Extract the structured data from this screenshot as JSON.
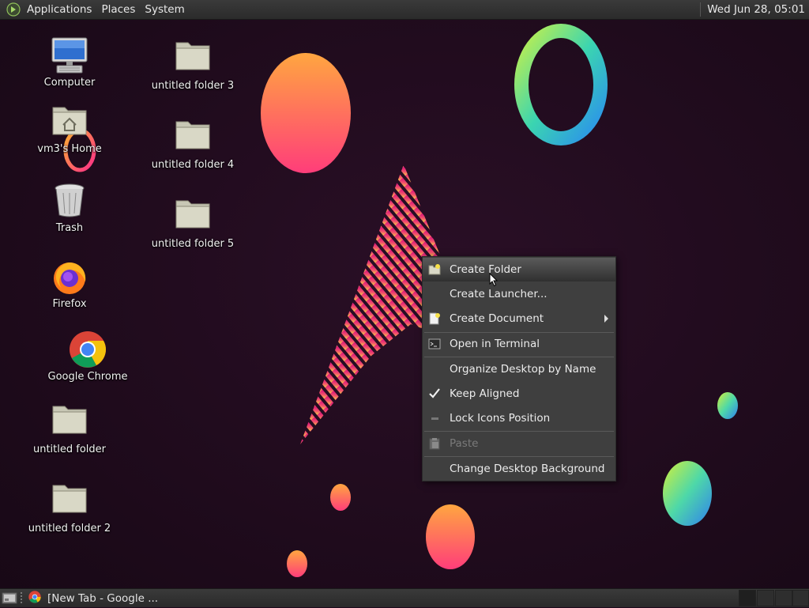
{
  "top_panel": {
    "menus": [
      "Applications",
      "Places",
      "System"
    ],
    "clock": "Wed Jun 28, 05:01"
  },
  "desktop": {
    "icons": [
      {
        "label": "Computer",
        "icon": "computer-icon"
      },
      {
        "label": "vm3's Home",
        "icon": "home-folder-icon"
      },
      {
        "label": "Trash",
        "icon": "trash-icon"
      },
      {
        "label": "Firefox",
        "icon": "firefox-icon"
      },
      {
        "label": "Google Chrome",
        "icon": "chrome-icon"
      },
      {
        "label": "untitled folder",
        "icon": "folder-icon"
      },
      {
        "label": "untitled folder 2",
        "icon": "folder-icon"
      },
      {
        "label": "untitled folder 3",
        "icon": "folder-icon"
      },
      {
        "label": "untitled folder 4",
        "icon": "folder-icon"
      },
      {
        "label": "untitled folder 5",
        "icon": "folder-icon"
      }
    ]
  },
  "context_menu": {
    "items": [
      {
        "label": "Create Folder",
        "icon": "folder-new-icon",
        "highlighted": true
      },
      {
        "label": "Create Launcher...",
        "icon": ""
      },
      {
        "label": "Create Document",
        "icon": "document-new-icon",
        "submenu": true
      },
      {
        "label": "Open in Terminal",
        "icon": "terminal-icon"
      },
      {
        "label": "Organize Desktop by Name",
        "icon": ""
      },
      {
        "label": "Keep Aligned",
        "icon": "checkmark-icon",
        "checked": true
      },
      {
        "label": "Lock Icons Position",
        "icon": "lock-toggle-icon"
      },
      {
        "label": "Paste",
        "icon": "paste-icon",
        "disabled": true
      },
      {
        "label": "Change Desktop Background",
        "icon": ""
      }
    ]
  },
  "bottom_panel": {
    "task_label": "[New Tab - Google ..."
  },
  "colors": {
    "panel": "#2f2f2f",
    "menu_bg": "#3f3f3f",
    "wallpaper": "#1e0a1c"
  }
}
